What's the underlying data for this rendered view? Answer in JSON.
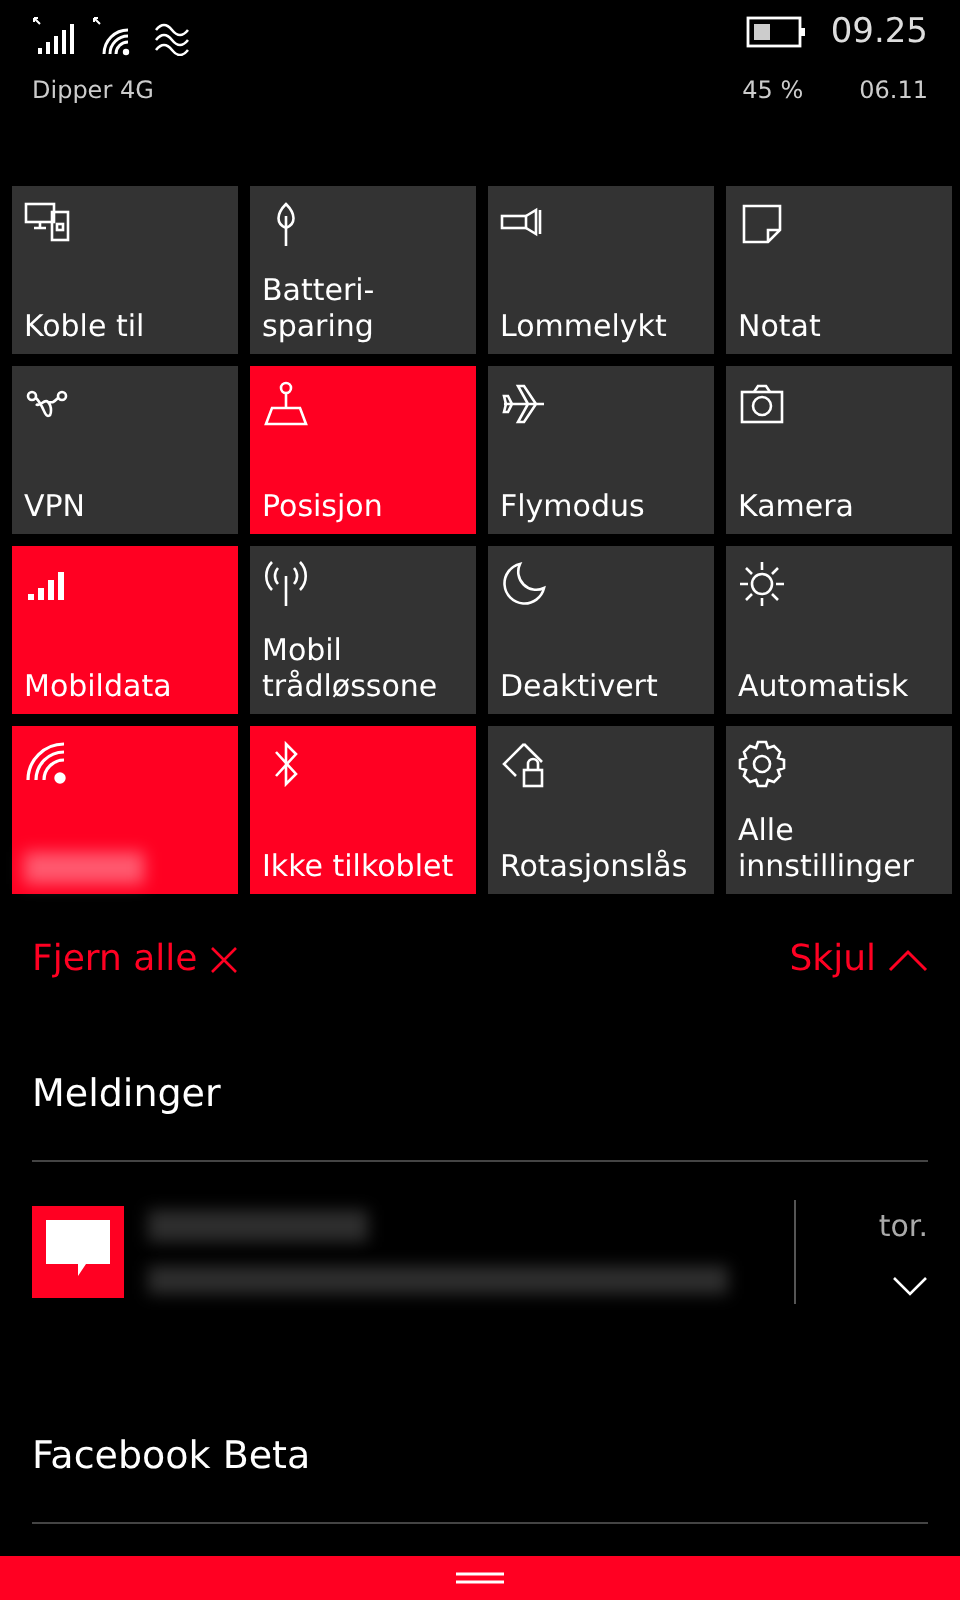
{
  "status_bar": {
    "time": "09.25",
    "carrier": "Dipper 4G",
    "battery": "45 %",
    "date": "06.11"
  },
  "tiles": [
    {
      "label": "Koble til",
      "on": false
    },
    {
      "label": "Batteri-sparing",
      "on": false
    },
    {
      "label": "Lommelykt",
      "on": false
    },
    {
      "label": "Notat",
      "on": false
    },
    {
      "label": "VPN",
      "on": false
    },
    {
      "label": "Posisjon",
      "on": true
    },
    {
      "label": "Flymodus",
      "on": false
    },
    {
      "label": "Kamera",
      "on": false
    },
    {
      "label": "Mobildata",
      "on": true
    },
    {
      "label": "Mobil trådløssone",
      "on": false
    },
    {
      "label": "Deaktivert",
      "on": false
    },
    {
      "label": "Automatisk",
      "on": false
    },
    {
      "on": true,
      "kind": "redacted"
    },
    {
      "label": "Ikke tilkoblet",
      "on": true
    },
    {
      "label": "Rotasjonslås",
      "on": false
    },
    {
      "label": "Alle innstillinger",
      "on": false
    }
  ],
  "actions": {
    "clear_all": "Fjern alle",
    "collapse": "Skjul"
  },
  "groups": [
    {
      "title": "Meldinger",
      "notifications": [
        {
          "time": "tor."
        }
      ]
    },
    {
      "title": "Facebook Beta"
    }
  ]
}
